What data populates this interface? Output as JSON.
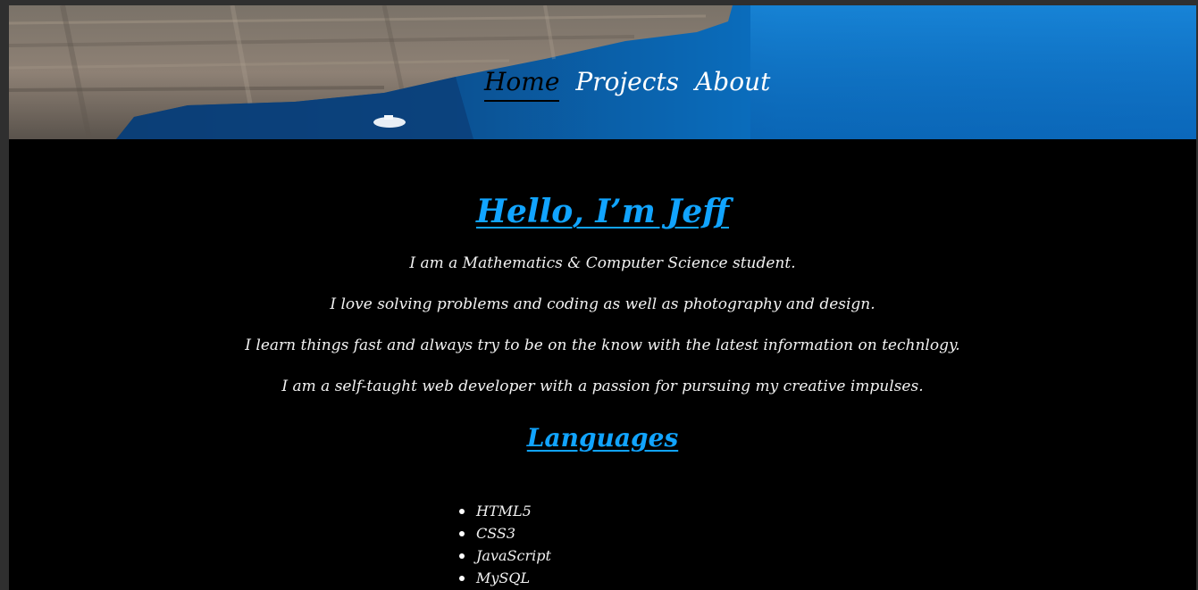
{
  "nav": {
    "items": [
      {
        "label": "Home",
        "active": true
      },
      {
        "label": "Projects",
        "active": false
      },
      {
        "label": "About",
        "active": false
      }
    ]
  },
  "hero": {
    "heading": "Hello, I’m Jeff",
    "paragraphs": [
      "I am a Mathematics & Computer Science student.",
      "I love solving problems and coding as well as photography and design.",
      "I learn things fast and always try to be on the know with the latest information on technlogy.",
      "I am a self-taught web developer with a passion for pursuing my creative impulses."
    ]
  },
  "languages": {
    "heading": "Languages",
    "items": [
      "HTML5",
      "CSS3",
      "JavaScript",
      "MySQL"
    ]
  },
  "colors": {
    "accent": "#11a4ff",
    "background": "#000000",
    "text": "#ffffff"
  },
  "icons": {
    "list_bullet": "bullet-icon"
  }
}
